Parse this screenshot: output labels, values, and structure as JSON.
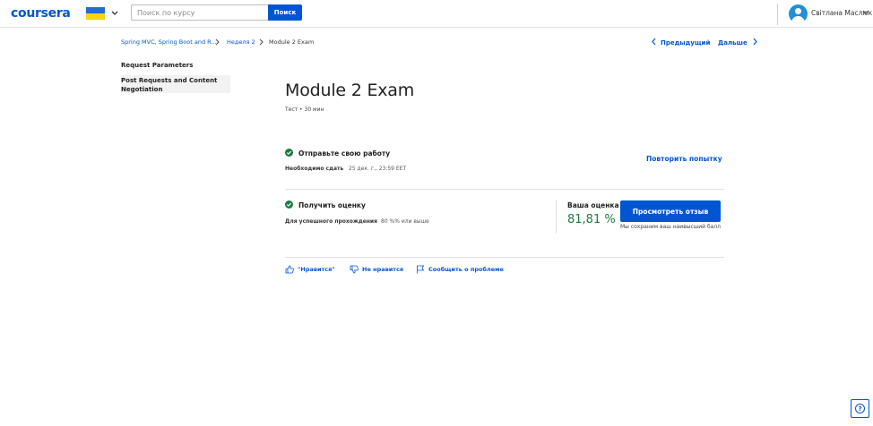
{
  "header": {
    "logo": "coursera",
    "search_placeholder": "Поиск по курсу",
    "search_button": "Поиск",
    "user_name": "Світлана Маслюк",
    "flag": "ukraine-flag"
  },
  "breadcrumb": {
    "course": "Spring MVC, Spring Boot and R...",
    "week": "Неделя 2",
    "current": "Module 2 Exam"
  },
  "nav": {
    "prev": "Предыдущий",
    "next": "Дальше"
  },
  "sidebar": {
    "items": [
      {
        "label": "Request Parameters"
      },
      {
        "label": "Post Requests and Content Negotiation"
      }
    ]
  },
  "main": {
    "title": "Module 2 Exam",
    "meta": "Тест • 30 мин",
    "submit": {
      "title": "Отправьте свою работу",
      "due_label": "Необходимо сдать",
      "due_value": "25 дек. г., 23:59 EET",
      "retry": "Повторить попытку"
    },
    "grade": {
      "title": "Получить оценку",
      "pass_label": "Для успешного прохождения",
      "pass_value": "80 %% или выше",
      "your_grade_label": "Ваша оценка",
      "your_grade_value": "81,81 %",
      "view_feedback": "Просмотреть отзыв",
      "save_note": "Мы сохраним ваш наивысший балл"
    },
    "actions": {
      "like": "\"Нравится\"",
      "dislike": "Не нравится",
      "report": "Сообщить о проблеме"
    }
  },
  "colors": {
    "brand": "#0056d2",
    "success": "#1d7a3f"
  }
}
